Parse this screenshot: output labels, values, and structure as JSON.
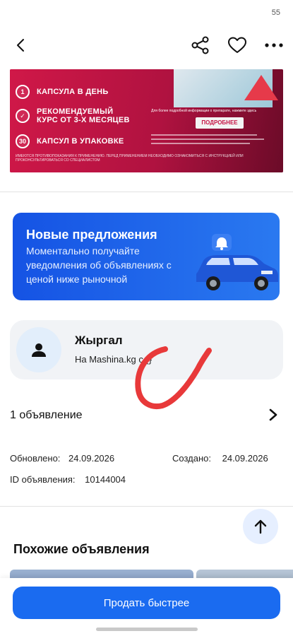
{
  "status_bar": {
    "number": "55"
  },
  "ad": {
    "rows": [
      {
        "badge": "1",
        "text": "КАПСУЛА В ДЕНЬ"
      },
      {
        "badge": "✓",
        "text": "РЕКОМЕНДУЕМЫЙ КУРС ОТ 3-Х МЕСЯЦЕВ"
      },
      {
        "badge": "30",
        "text": "КАПСУЛ В УПАКОВКЕ"
      }
    ],
    "more_button": "ПОДРОБНЕЕ",
    "info_text": "Для более подробной информации о препарате, нажмите здесь",
    "fine_print": "ИМЕЮТСЯ ПРОТИВОПОКАЗАНИЯ К ПРИМЕНЕНИЮ. ПЕРЕД ПРИМЕНЕНИЕМ НЕОБХОДИМО ОЗНАКОМИТЬСЯ С ИНСТРУКЦИЕЙ ИЛИ ПРОКОНСУЛЬТИРОВАТЬСЯ СО СПЕЦИАЛИСТОМ",
    "colors": {
      "background": "#b3123a",
      "accent": "#e63a4a"
    }
  },
  "promo": {
    "title": "Новые предложения",
    "description": "Моментально получайте уведомления об объявлениях с ценой ниже рыночной",
    "color": "#1a6bf0"
  },
  "seller": {
    "name": "Жыргал",
    "subtitle": "На Mashina.kg с {}"
  },
  "listings": {
    "label": "1 объявление"
  },
  "meta": {
    "updated_label": "Обновлено:",
    "updated_value": "24.09.2026",
    "created_label": "Создано:",
    "created_value": "24.09.2026",
    "id_label": "ID объявления:",
    "id_value": "10144004"
  },
  "similar": {
    "title": "Похожие объявления"
  },
  "sell_button": {
    "label": "Продать быстрее"
  },
  "icons": {
    "back": "chevron-left-icon",
    "share": "share-icon",
    "favorite": "heart-icon",
    "more": "more-horizontal-icon",
    "avatar": "person-icon",
    "listings": "chevron-right-icon",
    "scroll_up": "arrow-up-icon"
  }
}
